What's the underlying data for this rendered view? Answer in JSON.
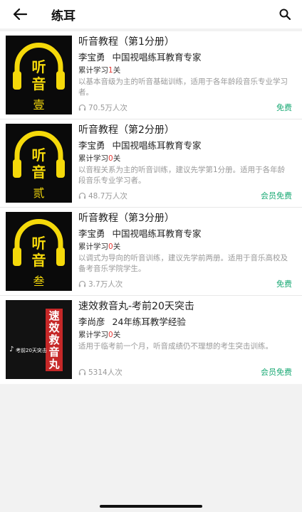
{
  "header": {
    "title": "练耳",
    "back_icon": "arrow-left-icon",
    "search_icon": "search-icon"
  },
  "courses": [
    {
      "cover": {
        "line1": "听",
        "line2": "音",
        "volume": "壹"
      },
      "title": "听音教程（第1分册）",
      "author": "李宝勇",
      "author_title": "中国视唱练耳教育专家",
      "progress_prefix": "累计学习",
      "progress_num": "1",
      "progress_suffix": "关",
      "desc": "以基本音级为主的听音基础训练，适用于各年龄段音乐专业学习者。",
      "views": "70.5万人次",
      "price": "免费"
    },
    {
      "cover": {
        "line1": "听",
        "line2": "音",
        "volume": "贰"
      },
      "title": "听音教程（第2分册）",
      "author": "李宝勇",
      "author_title": "中国视唱练耳教育专家",
      "progress_prefix": "累计学习",
      "progress_num": "0",
      "progress_suffix": "关",
      "desc": "以音程关系为主的听音训练，建议先学第1分册。适用于各年龄段音乐专业学习者。",
      "views": "48.7万人次",
      "price": "会员免费"
    },
    {
      "cover": {
        "line1": "听",
        "line2": "音",
        "volume": "叁"
      },
      "title": "听音教程（第3分册）",
      "author": "李宝勇",
      "author_title": "中国视唱练耳教育专家",
      "progress_prefix": "累计学习",
      "progress_num": "0",
      "progress_suffix": "关",
      "desc": "以调式为导向的听音训练，建议先学前两册。适用于音乐高校及备考音乐学院学生。",
      "views": "3.7万人次",
      "price": "免费"
    },
    {
      "cover": {
        "vertical": "速效救音丸",
        "sub": "考前20天突击"
      },
      "title": "速效救音丸-考前20天突击",
      "author": "李尚彦",
      "author_title": "24年练耳教学经验",
      "progress_prefix": "累计学习",
      "progress_num": "0",
      "progress_suffix": "关",
      "desc": "适用于临考前一个月，听音成绩仍不理想的考生突击训练。",
      "views": "5314人次",
      "price": "会员免费"
    }
  ],
  "colors": {
    "accent_green": "#19a974",
    "progress_red": "#e53935",
    "cover_yellow": "#f5d90a"
  }
}
